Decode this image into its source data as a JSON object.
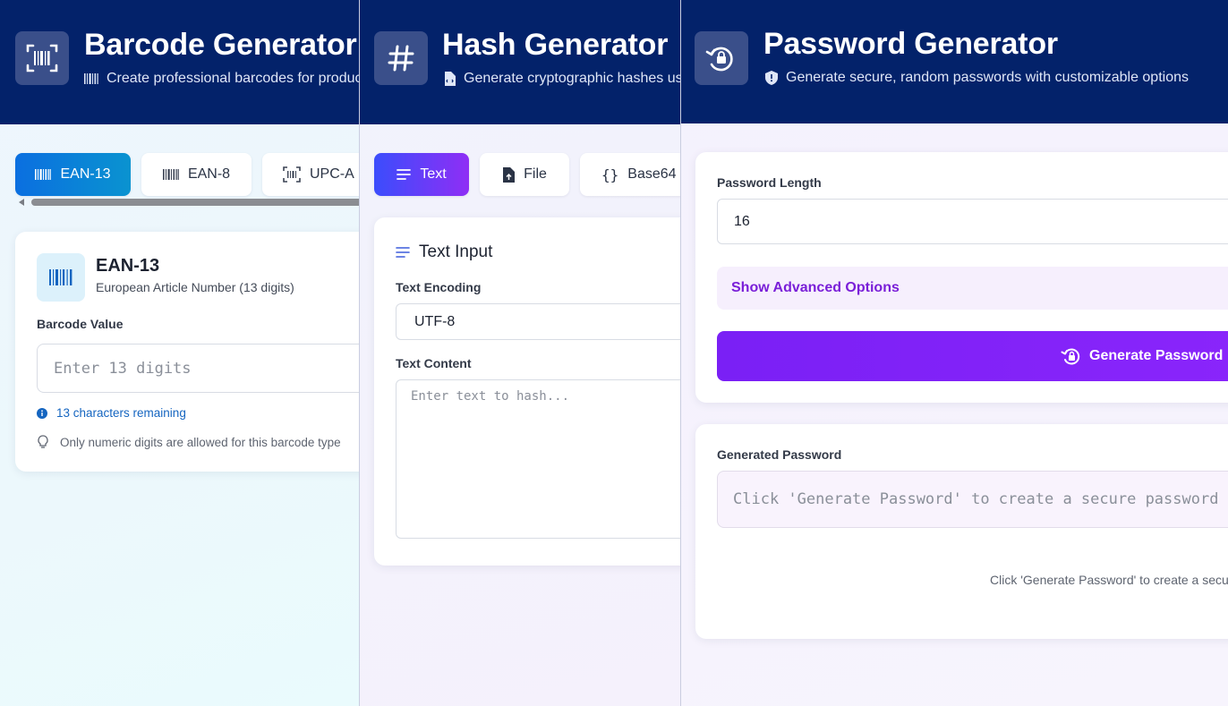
{
  "barcode": {
    "title": "Barcode Generator",
    "subtitle": "Create professional barcodes for produc",
    "tabs": [
      {
        "label": "EAN-13",
        "icon": "barcode-icon",
        "active": true
      },
      {
        "label": "EAN-8",
        "icon": "barcode-icon",
        "active": false
      },
      {
        "label": "UPC-A",
        "icon": "barcode-scan-icon",
        "active": false
      }
    ],
    "card": {
      "title": "EAN-13",
      "subtitle": "European Article Number (13 digits)",
      "value_label": "Barcode Value",
      "value_placeholder": "Enter 13 digits",
      "remaining": "13 characters remaining",
      "hint": "Only numeric digits are allowed for this barcode type"
    }
  },
  "hash": {
    "title": "Hash Generator",
    "subtitle": "Generate cryptographic hashes usi",
    "tabs": [
      {
        "label": "Text",
        "icon": "lines-icon",
        "active": true
      },
      {
        "label": "File",
        "icon": "file-upload-icon",
        "active": false
      },
      {
        "label": "Base64",
        "icon": "braces-icon",
        "active": false
      }
    ],
    "card": {
      "title": "Text Input",
      "encoding_label": "Text Encoding",
      "encoding_value": "UTF-8",
      "content_label": "Text Content",
      "content_placeholder": "Enter text to hash..."
    }
  },
  "password": {
    "title": "Password Generator",
    "subtitle": "Generate secure, random passwords with customizable options",
    "length_label": "Password Length",
    "length_value": "16",
    "advanced_label": "Show Advanced Options",
    "generate_label": "Generate Password",
    "output_label": "Generated Password",
    "output_placeholder": "Click 'Generate Password' to create a secure password",
    "empty_note": "Click 'Generate Password' to create a secure"
  },
  "colors": {
    "header": "#03226a",
    "barcode_accent": "#0a7fd6",
    "hash_accent_start": "#3b4dfc",
    "hash_accent_end": "#8f2ef5",
    "password_accent": "#7d22f6",
    "link_blue": "#1565c0"
  }
}
